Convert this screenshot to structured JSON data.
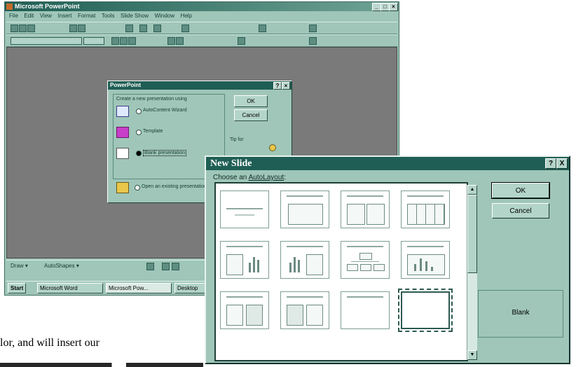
{
  "powerpoint_window": {
    "title": "Microsoft PowerPoint",
    "menu": [
      "File",
      "Edit",
      "View",
      "Insert",
      "Format",
      "Tools",
      "Slide Show",
      "Window",
      "Help"
    ],
    "drawing_toolbar": [
      "Draw ▾",
      "AutoShapes ▾"
    ],
    "taskbar": [
      "Start",
      "Microsoft Word",
      "Microsoft Pow...",
      "Desktop"
    ]
  },
  "startup_dialog": {
    "title": "PowerPoint",
    "prompt": "Create a new presentation using",
    "options": [
      "AutoContent Wizard",
      "Template",
      "Blank presentation",
      "Open an existing presentation"
    ],
    "ok_label": "OK",
    "cancel_label": "Cancel",
    "tip_label": "Tip for"
  },
  "new_slide_dialog": {
    "title": "New Slide",
    "help_label": "?",
    "close_label": "X",
    "autolayout_prefix": "Choose an ",
    "autolayout_underlined": "AutoLayout",
    "autolayout_suffix": ":",
    "ok_label": "OK",
    "cancel_label": "Cancel",
    "selected_layout": "Blank",
    "scroll_up": "▲",
    "scroll_down": "▼"
  },
  "background_document": {
    "line1": "lor, and will insert our"
  }
}
